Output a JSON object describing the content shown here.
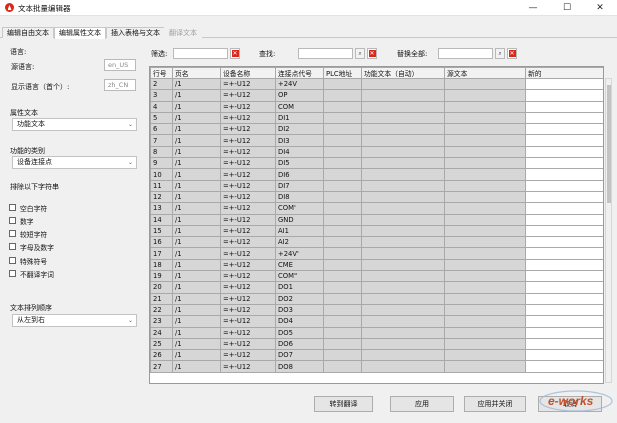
{
  "window": {
    "title": "文本批量编辑器",
    "min_glyph": "—",
    "max_glyph": "☐",
    "close_glyph": "✕"
  },
  "tabs": [
    {
      "label": "编辑自由文本",
      "state": "normal"
    },
    {
      "label": "编辑属性文本",
      "state": "active"
    },
    {
      "label": "插入表格与文本",
      "state": "normal"
    },
    {
      "label": "翻译文本",
      "state": "disabled"
    }
  ],
  "left": {
    "language_label": "语言:",
    "source_language_label": "源语言:",
    "source_language_value": "en_US",
    "display_language_label": "显示语言（首个）:",
    "display_language_value": "zh_CN",
    "property_text_label": "属性文本",
    "property_text_value": "功能文本",
    "function_category_label": "功能的类别",
    "function_category_value": "设备连接点",
    "exclude_label": "排除以下字符串",
    "exclude_options": [
      {
        "label": "空白字符",
        "checked": false
      },
      {
        "label": "数字",
        "checked": false
      },
      {
        "label": "较短字符",
        "checked": false
      },
      {
        "label": "字母及数字",
        "checked": false
      },
      {
        "label": "特殊符号",
        "checked": false
      },
      {
        "label": "不翻译字词",
        "checked": false
      }
    ],
    "text_order_label": "文本排列顺序",
    "text_order_value": "从左到右"
  },
  "filter": {
    "filter_label": "筛选:",
    "find_label": "查找:",
    "replace_all_label": "替换全部:",
    "clear_glyph": "✕"
  },
  "table": {
    "columns": [
      "行号",
      "页名",
      "设备名称",
      "连接点代号",
      "PLC地址",
      "功能文本（自动）",
      "源文本",
      "新的"
    ],
    "rows": [
      [
        "2",
        "/1",
        "=+-U12",
        "+24V",
        "",
        "",
        "",
        ""
      ],
      [
        "3",
        "/1",
        "=+-U12",
        "OP",
        "",
        "",
        "",
        ""
      ],
      [
        "4",
        "/1",
        "=+-U12",
        "COM",
        "",
        "",
        "",
        ""
      ],
      [
        "5",
        "/1",
        "=+-U12",
        "DI1",
        "",
        "",
        "",
        ""
      ],
      [
        "6",
        "/1",
        "=+-U12",
        "DI2",
        "",
        "",
        "",
        ""
      ],
      [
        "7",
        "/1",
        "=+-U12",
        "DI3",
        "",
        "",
        "",
        ""
      ],
      [
        "8",
        "/1",
        "=+-U12",
        "DI4",
        "",
        "",
        "",
        ""
      ],
      [
        "9",
        "/1",
        "=+-U12",
        "DI5",
        "",
        "",
        "",
        ""
      ],
      [
        "10",
        "/1",
        "=+-U12",
        "DI6",
        "",
        "",
        "",
        ""
      ],
      [
        "11",
        "/1",
        "=+-U12",
        "DI7",
        "",
        "",
        "",
        ""
      ],
      [
        "12",
        "/1",
        "=+-U12",
        "DI8",
        "",
        "",
        "",
        ""
      ],
      [
        "13",
        "/1",
        "=+-U12",
        "COM'",
        "",
        "",
        "",
        ""
      ],
      [
        "14",
        "/1",
        "=+-U12",
        "GND",
        "",
        "",
        "",
        ""
      ],
      [
        "15",
        "/1",
        "=+-U12",
        "AI1",
        "",
        "",
        "",
        ""
      ],
      [
        "16",
        "/1",
        "=+-U12",
        "AI2",
        "",
        "",
        "",
        ""
      ],
      [
        "17",
        "/1",
        "=+-U12",
        "+24V'",
        "",
        "",
        "",
        ""
      ],
      [
        "18",
        "/1",
        "=+-U12",
        "CME",
        "",
        "",
        "",
        ""
      ],
      [
        "19",
        "/1",
        "=+-U12",
        "COM\"",
        "",
        "",
        "",
        ""
      ],
      [
        "20",
        "/1",
        "=+-U12",
        "DO1",
        "",
        "",
        "",
        ""
      ],
      [
        "21",
        "/1",
        "=+-U12",
        "DO2",
        "",
        "",
        "",
        ""
      ],
      [
        "22",
        "/1",
        "=+-U12",
        "DO3",
        "",
        "",
        "",
        ""
      ],
      [
        "23",
        "/1",
        "=+-U12",
        "DO4",
        "",
        "",
        "",
        ""
      ],
      [
        "24",
        "/1",
        "=+-U12",
        "DO5",
        "",
        "",
        "",
        ""
      ],
      [
        "25",
        "/1",
        "=+-U12",
        "DO6",
        "",
        "",
        "",
        ""
      ],
      [
        "26",
        "/1",
        "=+-U12",
        "DO7",
        "",
        "",
        "",
        ""
      ],
      [
        "27",
        "/1",
        "=+-U12",
        "DO8",
        "",
        "",
        "",
        ""
      ]
    ]
  },
  "buttons": {
    "goto_translate": "转到翻译",
    "apply": "应用",
    "apply_close": "应用并关闭",
    "cancel": "取消"
  },
  "watermark": {
    "text": "e-works"
  },
  "colors": {
    "accent_red": "#d9291c",
    "grid_cell": "#d6d6d6",
    "background": "#f0f0f0"
  }
}
